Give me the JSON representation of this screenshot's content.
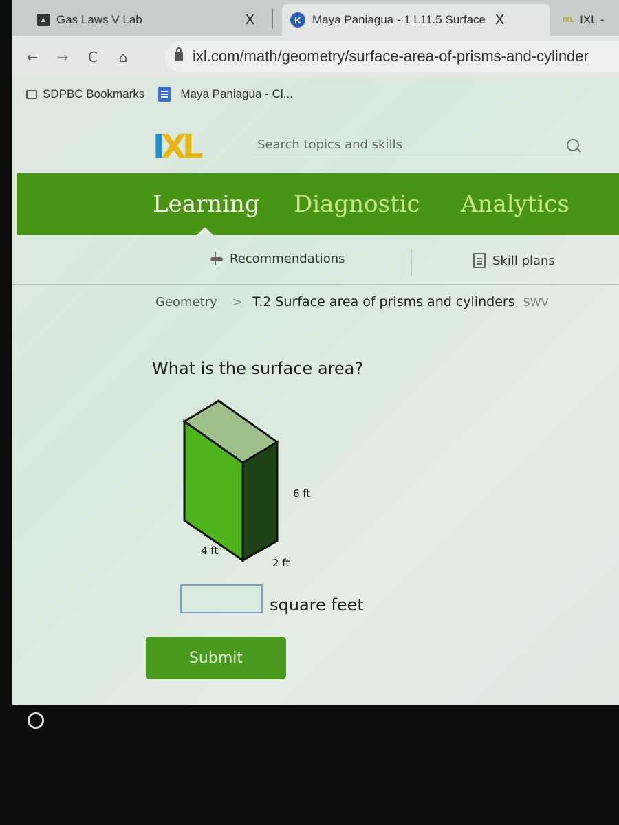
{
  "browser": {
    "tabs": [
      {
        "title": "Gas Laws V Lab",
        "favicon": "document-icon",
        "close_label": "X"
      },
      {
        "title": "Maya Paniagua - 1 L11.5 Surface",
        "favicon": "k-icon",
        "favicon_letter": "K",
        "close_label": "X",
        "active": true
      },
      {
        "title": "IXL -",
        "favicon": "ixl-icon",
        "favicon_text": "IXL"
      }
    ],
    "nav": {
      "back": "←",
      "forward": "→",
      "reload": "C",
      "home": "⌂"
    },
    "url": "ixl.com/math/geometry/surface-area-of-prisms-and-cylinder",
    "bookmarks": [
      {
        "label": "SDPBC Bookmarks",
        "icon": "folder-icon"
      },
      {
        "label": "Maya Paniagua - Cl...",
        "icon": "doc-icon"
      }
    ]
  },
  "ixl": {
    "logo": {
      "i": "I",
      "x": "X",
      "l": "L"
    },
    "search": {
      "placeholder": "Search topics and skills"
    },
    "main_nav": [
      {
        "label": "Learning",
        "active": true
      },
      {
        "label": "Diagnostic",
        "active": false
      },
      {
        "label": "Analytics",
        "active": false
      }
    ],
    "sub_nav": [
      {
        "label": "Recommendations",
        "icon": "recommendations-icon"
      },
      {
        "label": "Skill plans",
        "icon": "skill-plans-icon"
      }
    ],
    "colors": {
      "nav_green": "#4a9415",
      "logo_blue": "#1b8fd0",
      "logo_yellow": "#e8b612",
      "submit_green": "#4a9a1f"
    }
  },
  "breadcrumb": {
    "root": "Geometry",
    "separator": ">",
    "skill": "T.2 Surface area of prisms and cylinders",
    "code": "SWV"
  },
  "problem": {
    "question": "What is the surface area?",
    "figure": {
      "shape": "rectangular prism",
      "height_label": "6 ft",
      "length_label": "4 ft",
      "width_label": "2 ft"
    },
    "answer": {
      "value": "",
      "unit": "square feet"
    },
    "submit_label": "Submit"
  }
}
